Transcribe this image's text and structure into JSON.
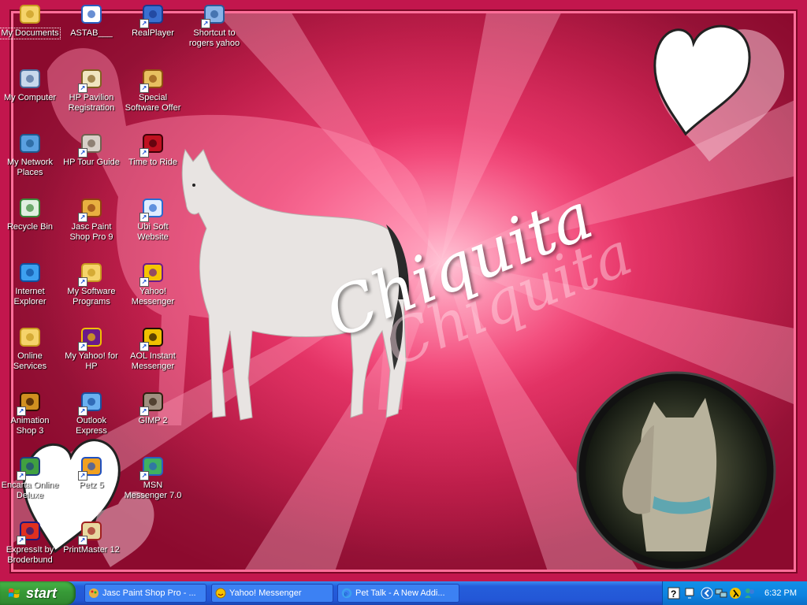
{
  "desktop": {
    "wallpaper_text": "Chiquita",
    "icons": [
      {
        "label": "My Documents",
        "icon": "folder-documents-icon",
        "selected": true
      },
      {
        "label": "ASTAB___",
        "icon": "font-file-icon"
      },
      {
        "label": "RealPlayer",
        "icon": "realplayer-icon"
      },
      {
        "label": "Shortcut to rogers yahoo",
        "icon": "network-shortcut-icon"
      },
      {
        "label": "My Computer",
        "icon": "computer-icon"
      },
      {
        "label": "HP Pavilion Registration",
        "icon": "registration-icon"
      },
      {
        "label": "Special Software Offer",
        "icon": "cd-icon"
      },
      {
        "label": "My Network Places",
        "icon": "network-places-icon"
      },
      {
        "label": "HP Tour Guide",
        "icon": "tour-guide-icon"
      },
      {
        "label": "Time to Ride",
        "icon": "game-icon"
      },
      {
        "label": "Recycle Bin",
        "icon": "recycle-bin-icon"
      },
      {
        "label": "Jasc Paint Shop Pro 9",
        "icon": "paint-shop-icon"
      },
      {
        "label": "Ubi Soft Website",
        "icon": "web-link-icon"
      },
      {
        "label": "Internet Explorer",
        "icon": "internet-explorer-icon"
      },
      {
        "label": "My Software Programs",
        "icon": "programs-folder-icon"
      },
      {
        "label": "Yahoo! Messenger",
        "icon": "yahoo-messenger-icon"
      },
      {
        "label": "Online Services",
        "icon": "folder-icon"
      },
      {
        "label": "My Yahoo! for HP",
        "icon": "my-yahoo-icon"
      },
      {
        "label": "AOL Instant Messenger",
        "icon": "aim-icon"
      },
      {
        "label": "Animation Shop 3",
        "icon": "animation-shop-icon"
      },
      {
        "label": "Outlook Express",
        "icon": "outlook-express-icon"
      },
      {
        "label": "GIMP 2",
        "icon": "gimp-icon"
      },
      {
        "label": "Encarta Online Deluxe",
        "icon": "encarta-icon"
      },
      {
        "label": "Petz 5",
        "icon": "petz-icon"
      },
      {
        "label": "MSN Messenger 7.0",
        "icon": "msn-messenger-icon"
      },
      {
        "label": "ExpressIt by Broderbund",
        "icon": "expressit-icon"
      },
      {
        "label": "PrintMaster 12",
        "icon": "printmaster-icon"
      }
    ]
  },
  "taskbar": {
    "start_label": "start",
    "tasks": [
      {
        "label": "Jasc Paint Shop Pro - ...",
        "icon": "paint-shop-icon"
      },
      {
        "label": "Yahoo! Messenger",
        "icon": "yahoo-messenger-icon"
      },
      {
        "label": "Pet Talk - A New Addi...",
        "icon": "internet-explorer-icon"
      }
    ],
    "clock": "6:32 PM"
  },
  "colors": {
    "taskbar_blue": "#245edb",
    "start_green": "#379a37",
    "wallpaper_pink": "#e8215a"
  }
}
